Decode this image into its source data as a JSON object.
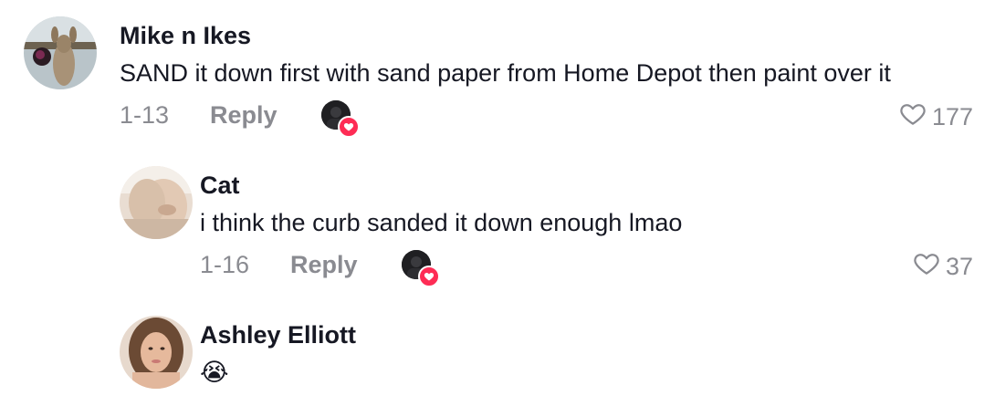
{
  "comments": [
    {
      "username": "Mike n Ikes",
      "text": "SAND it down first with sand paper from Home Depot then paint over it",
      "date": "1-13",
      "reply_label": "Reply",
      "likes": "177",
      "liked_by_creator": true
    },
    {
      "username": "Cat",
      "text": "i think the curb sanded it down enough lmao",
      "date": "1-16",
      "reply_label": "Reply",
      "likes": "37",
      "liked_by_creator": true
    },
    {
      "username": "Ashley Elliott",
      "text": "😭"
    }
  ],
  "icons": {
    "like": "heart-outline-icon",
    "creator_like": "heart-badge-icon"
  },
  "colors": {
    "primary_text": "#161823",
    "secondary_text": "#8a8b91",
    "accent": "#fe2c55"
  }
}
